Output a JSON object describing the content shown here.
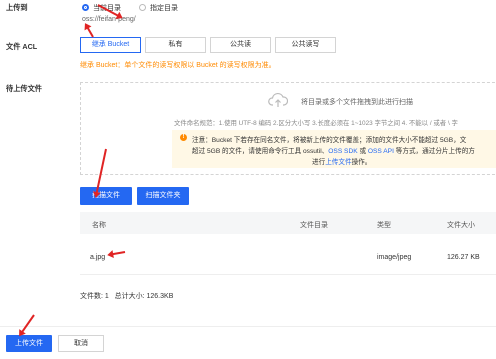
{
  "upload_to": {
    "label": "上传到",
    "options": [
      "当前目录",
      "指定目录"
    ],
    "path": "oss://feifan-peng/"
  },
  "acl": {
    "label": "文件 ACL",
    "options": [
      "继承 Bucket",
      "私有",
      "公共读",
      "公共读写"
    ],
    "hint": "继承 Bucket：单个文件的读写权限以 Bucket 的读写权限为准。"
  },
  "files_section": {
    "label": "待上传文件",
    "dropzone_text": "将目录或多个文件拖拽到此进行扫描",
    "naming_rule": "文件命名规范：1.使用 UTF-8 编码 2.区分大小写 3.长度必须在 1~1023 字节之间 4. 不能以 / 或者 \\ 字",
    "notice": {
      "prefix": "注意：Bucket 下若存在同名文件，将被新上传的文件覆盖；添加的文件大小不能超过 5GB，文",
      "line2_start": "超过 5GB 的文件，请使用命令行工具 ossutil、",
      "link1": "OSS SDK",
      "mid": " 或 ",
      "link2": "OSS API",
      "line2_end": " 等方式，通过分片上传的方",
      "line3_start": "进行",
      "link3": "上传文件",
      "line3_end": "操作。"
    },
    "scan_files": "扫描文件",
    "scan_folder": "扫描文件夹"
  },
  "table": {
    "headers": [
      "名称",
      "文件目录",
      "类型",
      "文件大小"
    ],
    "rows": [
      {
        "name": "a.jpg",
        "dir": "",
        "type": "image/jpeg",
        "size": "126.27 KB"
      }
    ]
  },
  "summary": "文件数: 1   总计大小: 126.3KB",
  "footer": {
    "upload": "上传文件",
    "cancel": "取消"
  },
  "colors": {
    "primary": "#2468f2",
    "warning": "#ff8a00",
    "annotation": "#e02424"
  }
}
